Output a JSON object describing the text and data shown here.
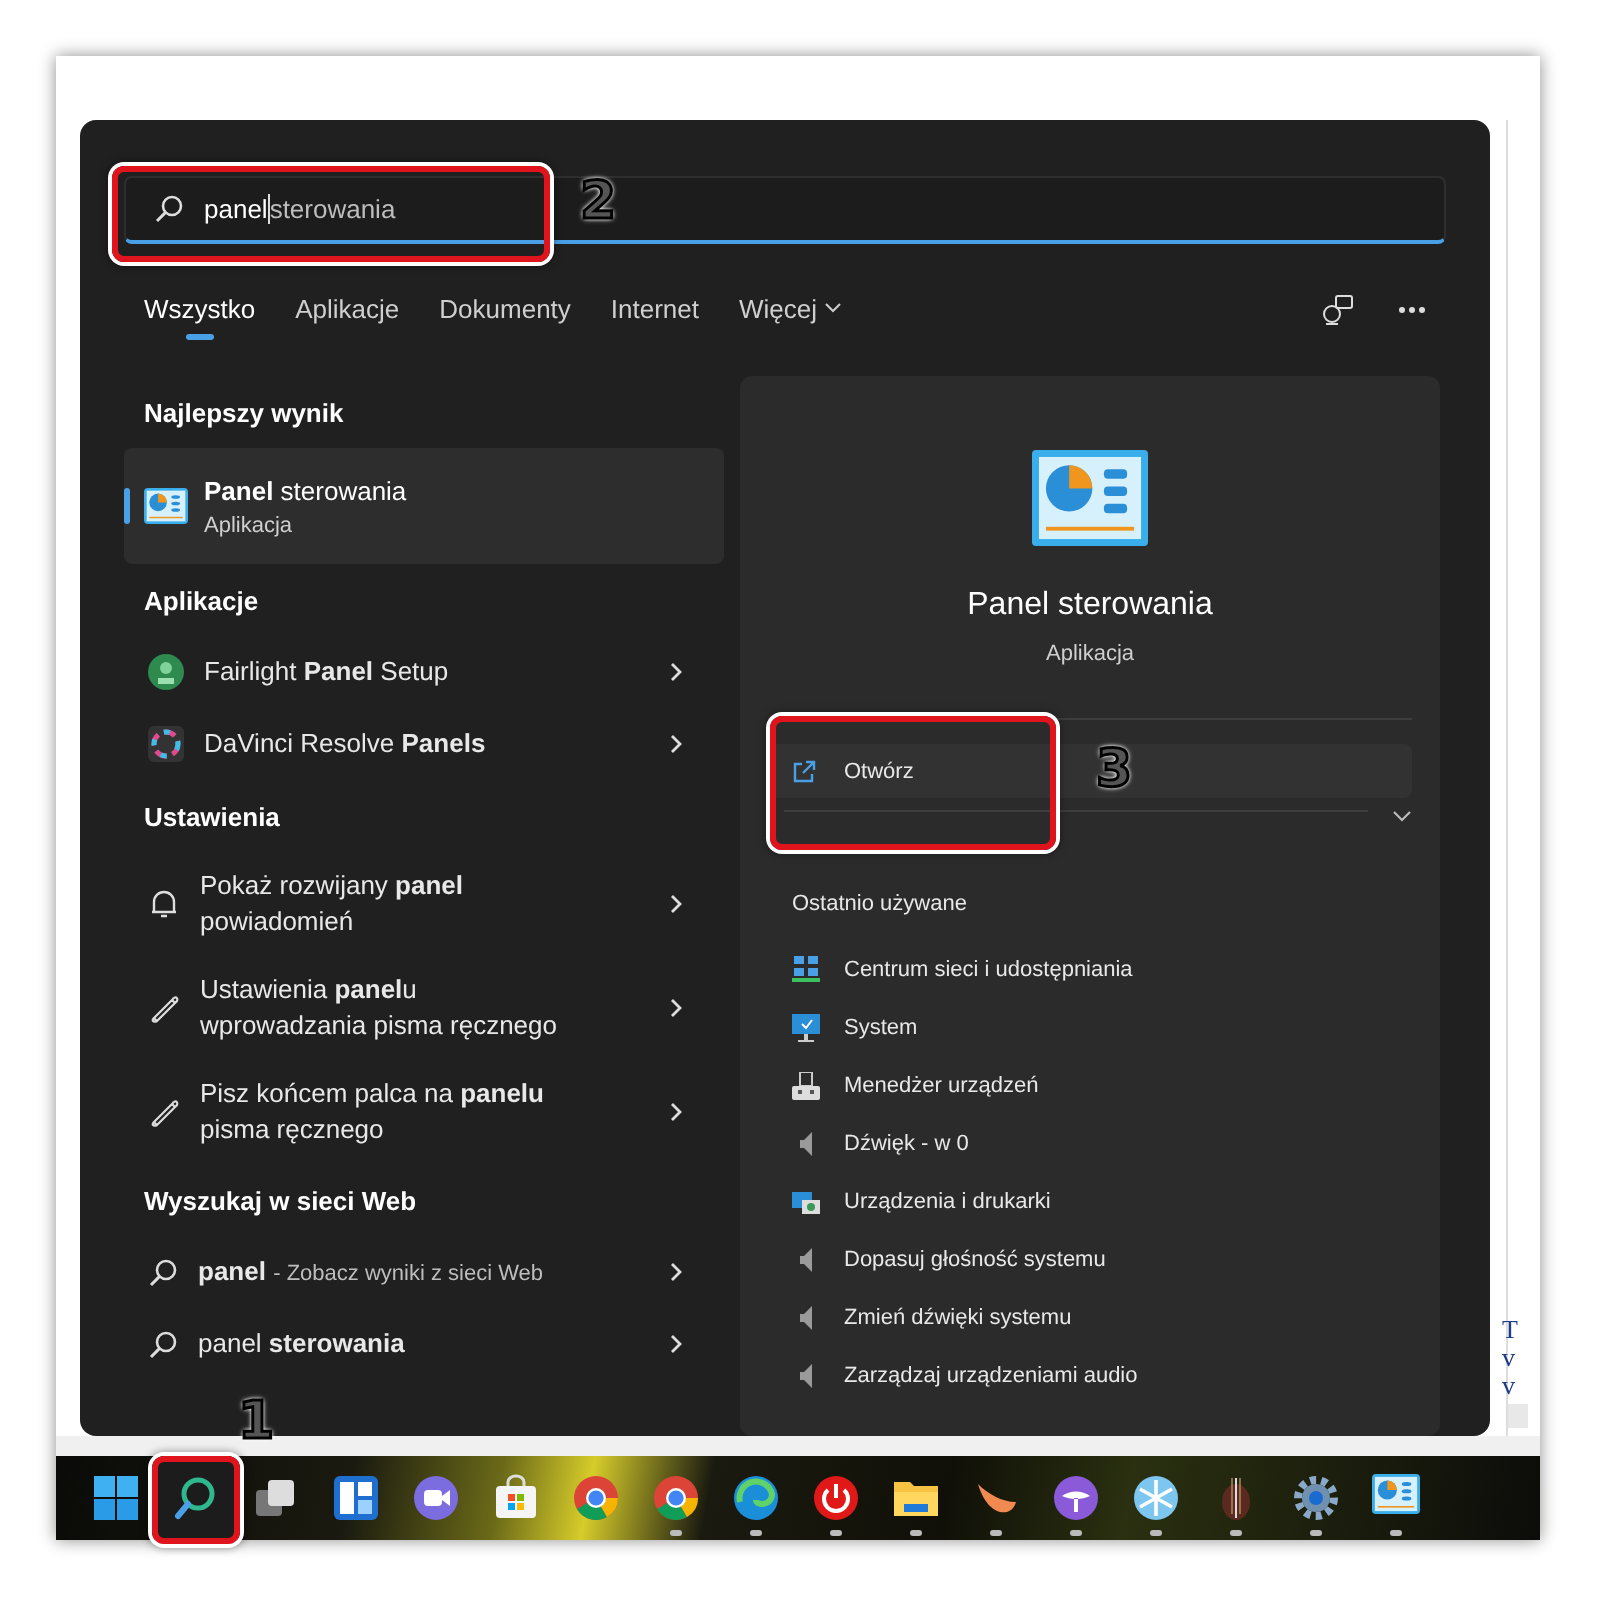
{
  "search": {
    "value": "panel",
    "completion": "sterowania"
  },
  "tabs": [
    {
      "label": "Wszystko",
      "selected": true,
      "kind": "tab"
    },
    {
      "label": "Aplikacje",
      "selected": false,
      "kind": "tab"
    },
    {
      "label": "Dokumenty",
      "selected": false,
      "kind": "tab"
    },
    {
      "label": "Internet",
      "selected": false,
      "kind": "tab"
    },
    {
      "label": "Więcej",
      "selected": false,
      "kind": "dropdown"
    }
  ],
  "sections": [
    {
      "title": "Najlepszy wynik",
      "items": [
        {
          "kind": "best",
          "title": "**Panel** sterowania",
          "subtitle": "Aplikacja",
          "selected": true
        }
      ]
    },
    {
      "title": "Aplikacje",
      "items": [
        {
          "kind": "item",
          "title": "Fairlight **Panel** Setup",
          "selected": false
        },
        {
          "kind": "item",
          "title": "DaVinci Resolve **Panels**",
          "selected": false
        }
      ]
    },
    {
      "title": "Ustawienia",
      "items": [
        {
          "kind": "item",
          "title": "Pokaż rozwijany **panel** powiadomień",
          "selected": false
        },
        {
          "kind": "item",
          "title": "Ustawienia **panel**u wprowadzania pisma ręcznego",
          "selected": false
        },
        {
          "kind": "item",
          "title": "Pisz końcem palca na **panelu** pisma ręcznego",
          "selected": false
        }
      ]
    },
    {
      "title": "Wyszukaj w sieci Web",
      "items": [
        {
          "kind": "item",
          "title": "**panel**",
          "note": "- Zobacz wyniki z sieci Web",
          "selected": false
        },
        {
          "kind": "item",
          "title": "panel **sterowania**",
          "selected": false
        }
      ]
    }
  ],
  "preview": {
    "title": "Panel sterowania",
    "subtitle": "Aplikacja",
    "actions": [
      {
        "label": "Otwórz"
      }
    ],
    "recent_title": "Ostatnio używane",
    "recent": [
      {
        "label": "Centrum sieci i udostępniania"
      },
      {
        "label": "System"
      },
      {
        "label": "Menedżer urządzeń"
      },
      {
        "label": "Dźwięk - w 0"
      },
      {
        "label": "Urządzenia i drukarki"
      },
      {
        "label": "Dopasuj głośność systemu"
      },
      {
        "label": "Zmień dźwięki systemu"
      },
      {
        "label": "Zarządzaj urządzeniami audio"
      }
    ]
  },
  "page_fragments": [
    "T",
    "v",
    "v"
  ],
  "taskbar": [
    {
      "selected": false,
      "running": false
    },
    {
      "selected": true,
      "running": false
    },
    {
      "selected": false,
      "running": false
    },
    {
      "selected": false,
      "running": false
    },
    {
      "selected": false,
      "running": false
    },
    {
      "selected": false,
      "running": false
    },
    {
      "selected": false,
      "running": false
    },
    {
      "selected": false,
      "running": true
    },
    {
      "selected": false,
      "running": true
    },
    {
      "selected": false,
      "running": true
    },
    {
      "selected": false,
      "running": true
    },
    {
      "selected": false,
      "running": true
    },
    {
      "selected": false,
      "running": true
    },
    {
      "selected": false,
      "running": true
    },
    {
      "selected": false,
      "running": true
    },
    {
      "selected": false,
      "running": true
    },
    {
      "selected": false,
      "running": true
    }
  ],
  "annotations": [
    {
      "kind": "taskbar",
      "label": "1"
    },
    {
      "kind": "search",
      "label": "2"
    },
    {
      "kind": "open",
      "label": "3"
    }
  ]
}
